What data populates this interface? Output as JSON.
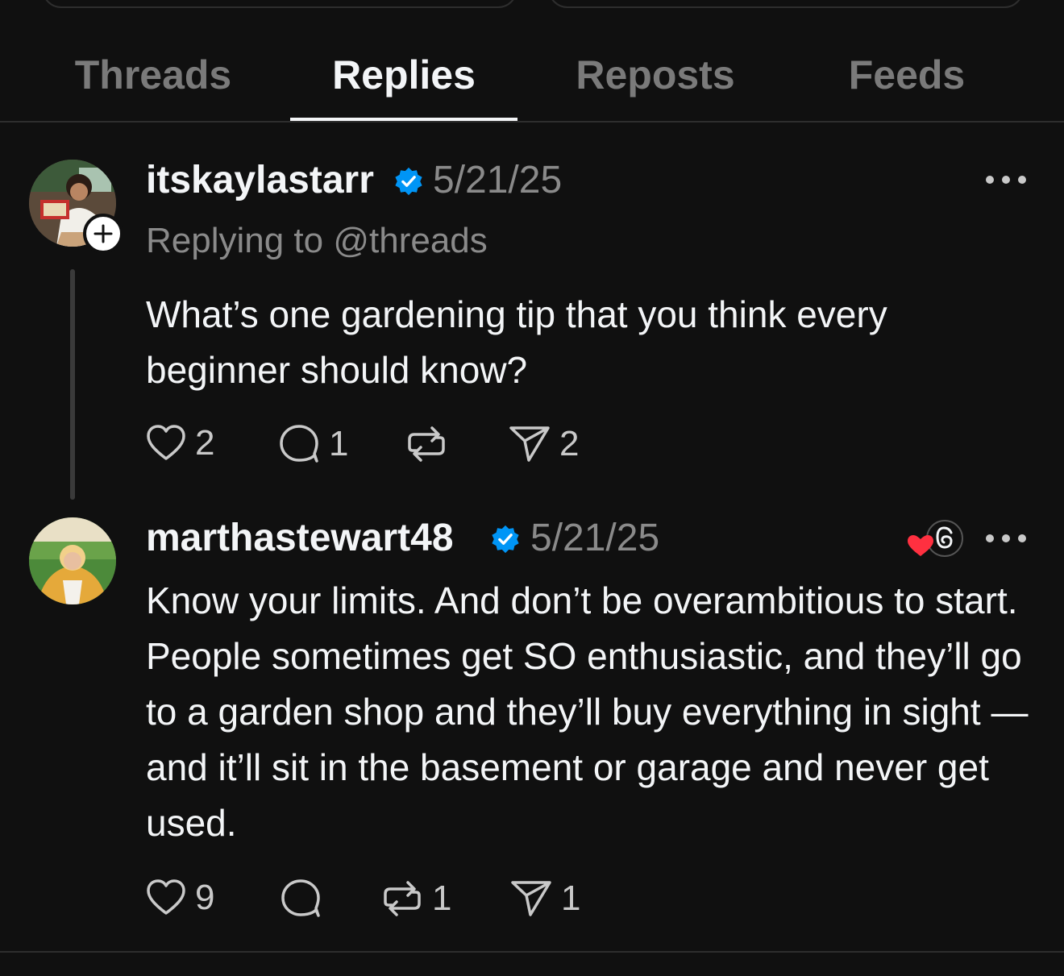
{
  "tabs": [
    {
      "label": "Threads",
      "active": false
    },
    {
      "label": "Replies",
      "active": true
    },
    {
      "label": "Reposts",
      "active": false
    },
    {
      "label": "Feeds",
      "active": false
    }
  ],
  "posts": [
    {
      "username": "itskaylastarr",
      "verified": true,
      "date": "5/21/25",
      "replying_to": "Replying to @threads",
      "text": "What’s one gardening tip that you think every beginner should know?",
      "likes": "2",
      "replies": "1",
      "reposts": "",
      "shares": "2"
    },
    {
      "username": "marthastewart48",
      "verified": true,
      "date": "5/21/25",
      "text": "Know your limits. And don’t be overambitious to start. People sometimes get SO enthusiastic, and they’ll go to a garden shop and they’ll buy everything in sight — and it’ll sit in the basement or garage and never get used.",
      "likes": "9",
      "replies": "",
      "reposts": "1",
      "shares": "1"
    }
  ],
  "colors": {
    "background": "#101010",
    "text": "#f3f5f7",
    "muted": "#8a8a8a",
    "verified": "#0095f6",
    "like_heart": "#ff3040"
  },
  "icons": [
    "heart-icon",
    "comment-icon",
    "repost-icon",
    "share-icon",
    "verified-icon",
    "more-icon",
    "plus-icon",
    "threads-logo-icon"
  ]
}
